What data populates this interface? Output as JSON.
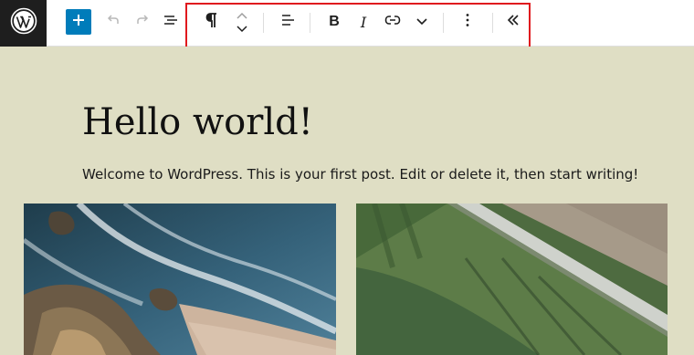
{
  "toolbar": {
    "wp_logo_icon": "wordpress-logo-icon",
    "add_block_icon": "plus-icon",
    "undo_icon": "undo-icon",
    "redo_icon": "redo-icon",
    "list_view_icon": "list-view-icon",
    "block_type_icon": "paragraph-icon",
    "move_up_icon": "chevron-up-icon",
    "move_down_icon": "chevron-down-icon",
    "align_icon": "align-left-icon",
    "bold_label": "B",
    "italic_label": "I",
    "link_icon": "link-icon",
    "more_format_icon": "chevron-down-icon",
    "options_icon": "more-vertical-icon",
    "collapse_icon": "chevrons-left-icon",
    "highlight_color": "#e0191e",
    "accent_color": "#007cba"
  },
  "post": {
    "title": "Hello world!",
    "paragraph": "Welcome to WordPress. This is your first post. Edit or delete it, then start writing!"
  },
  "gallery": {
    "images": [
      {
        "subject": "aerial coastline with waves and rocks"
      },
      {
        "subject": "aerial farm fields with a road"
      }
    ]
  },
  "colors": {
    "canvas_background": "#dfdec4",
    "topbar_background": "#ffffff",
    "logo_background": "#1e1e1e"
  }
}
